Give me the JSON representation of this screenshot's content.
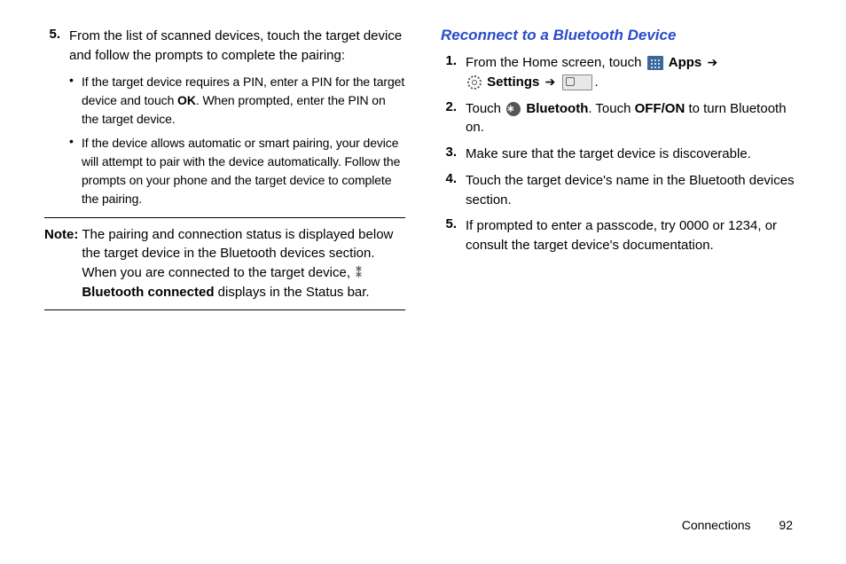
{
  "left": {
    "step5_num": "5.",
    "step5_text": "From the list of scanned devices, touch the target device and follow the prompts to complete the pairing:",
    "bullets": {
      "b1_pre": "If the target device requires a PIN, enter a PIN for the target device and touch ",
      "b1_bold": "OK",
      "b1_post": ". When prompted, enter the PIN on the target device.",
      "b2": "If the device allows automatic or smart pairing, your device will attempt to pair with the device automatically. Follow the prompts on your phone and the target device to complete the pairing."
    },
    "note_label": "Note:",
    "note_pre": "The pairing and connection status is displayed below the target device in the Bluetooth devices section. When you are connected to the target device, ",
    "note_bold": "Bluetooth connected",
    "note_post": " displays in the Status bar."
  },
  "right": {
    "heading": "Reconnect to a Bluetooth Device",
    "s1_num": "1.",
    "s1_pre": "From the Home screen, touch ",
    "s1_apps": "Apps",
    "s1_arrow1": "➔",
    "s1_settings": "Settings",
    "s1_arrow2": "➔",
    "s1_post": ".",
    "s2_num": "2.",
    "s2_pre": "Touch ",
    "s2_bt": "Bluetooth",
    "s2_mid": ". Touch ",
    "s2_offon": "OFF/ON",
    "s2_post": " to turn Bluetooth on.",
    "s3_num": "3.",
    "s3_text": "Make sure that the target device is discoverable.",
    "s4_num": "4.",
    "s4_text": "Touch the target device's name in the Bluetooth devices section.",
    "s5_num": "5.",
    "s5_text": "If prompted to enter a passcode, try 0000 or 1234, or consult the target device's documentation."
  },
  "footer": {
    "section": "Connections",
    "page": "92"
  },
  "glyphs": {
    "bt": "⁕",
    "bullet": "•"
  }
}
